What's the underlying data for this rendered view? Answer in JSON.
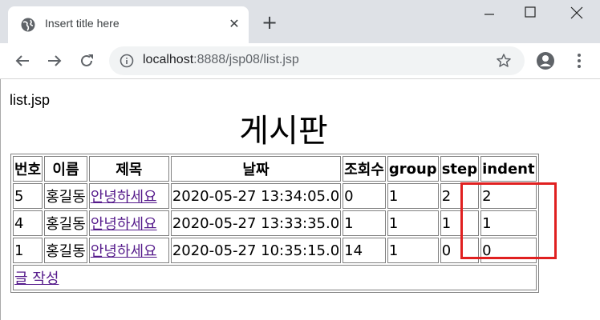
{
  "browser": {
    "tab_title": "Insert title here",
    "tab_close": "✕",
    "new_tab": "+",
    "url_host": "localhost",
    "url_path": ":8888/jsp08/list.jsp"
  },
  "page": {
    "file_label": "list.jsp",
    "title": "게시판"
  },
  "table": {
    "headers": [
      "번호",
      "이름",
      "제목",
      "날짜",
      "조회수",
      "group",
      "step",
      "indent"
    ],
    "rows": [
      [
        "5",
        "홍길동",
        "안녕하세요",
        "2020-05-27 13:34:05.0",
        "0",
        "1",
        "2",
        "2"
      ],
      [
        "4",
        "홍길동",
        "안녕하세요",
        "2020-05-27 13:33:35.0",
        "1",
        "1",
        "1",
        "1"
      ],
      [
        "1",
        "홍길동",
        "안녕하세요",
        "2020-05-27 10:35:15.0",
        "14",
        "1",
        "0",
        "0"
      ]
    ],
    "write_link": "글 작성"
  },
  "colors": {
    "highlight": "#e02020",
    "visited_link": "#551a8b",
    "chrome_frame": "#dee1e6"
  },
  "icons": [
    "globe-icon",
    "close-icon",
    "plus-icon",
    "minimize-icon",
    "maximize-icon",
    "window-close-icon",
    "back-arrow-icon",
    "forward-arrow-icon",
    "reload-icon",
    "info-icon",
    "star-icon",
    "profile-icon",
    "kebab-menu-icon"
  ]
}
